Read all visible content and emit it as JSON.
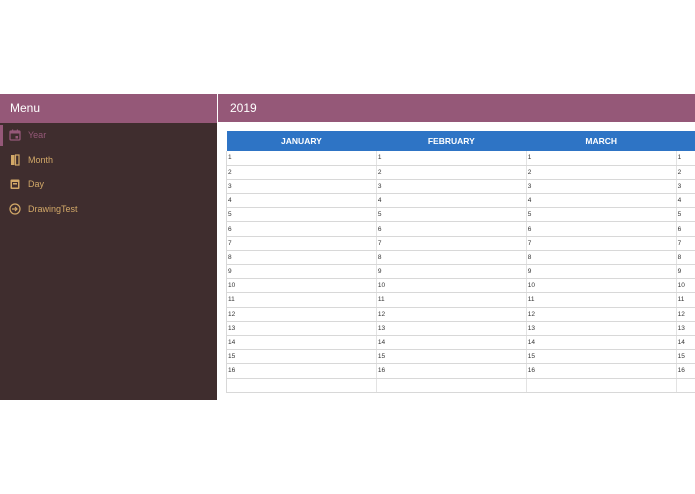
{
  "sidebar": {
    "title": "Menu",
    "items": [
      {
        "label": "Year",
        "icon": "calendar-icon",
        "active": true
      },
      {
        "label": "Month",
        "icon": "book-icon",
        "active": false
      },
      {
        "label": "Day",
        "icon": "calendar-day-icon",
        "active": false
      },
      {
        "label": "DrawingTest",
        "icon": "arrow-circle-icon",
        "active": false
      }
    ]
  },
  "main": {
    "title": "2019",
    "months": [
      "JANUARY",
      "FEBRUARY",
      "MARCH",
      ""
    ],
    "days": [
      "1",
      "2",
      "3",
      "4",
      "5",
      "6",
      "7",
      "8",
      "9",
      "10",
      "11",
      "12",
      "13",
      "14",
      "15",
      "16",
      ""
    ]
  },
  "colors": {
    "header": "#955878",
    "sidebar_bg": "#3f2d2e",
    "menu_text": "#d2a868",
    "table_header": "#2e74c5"
  }
}
